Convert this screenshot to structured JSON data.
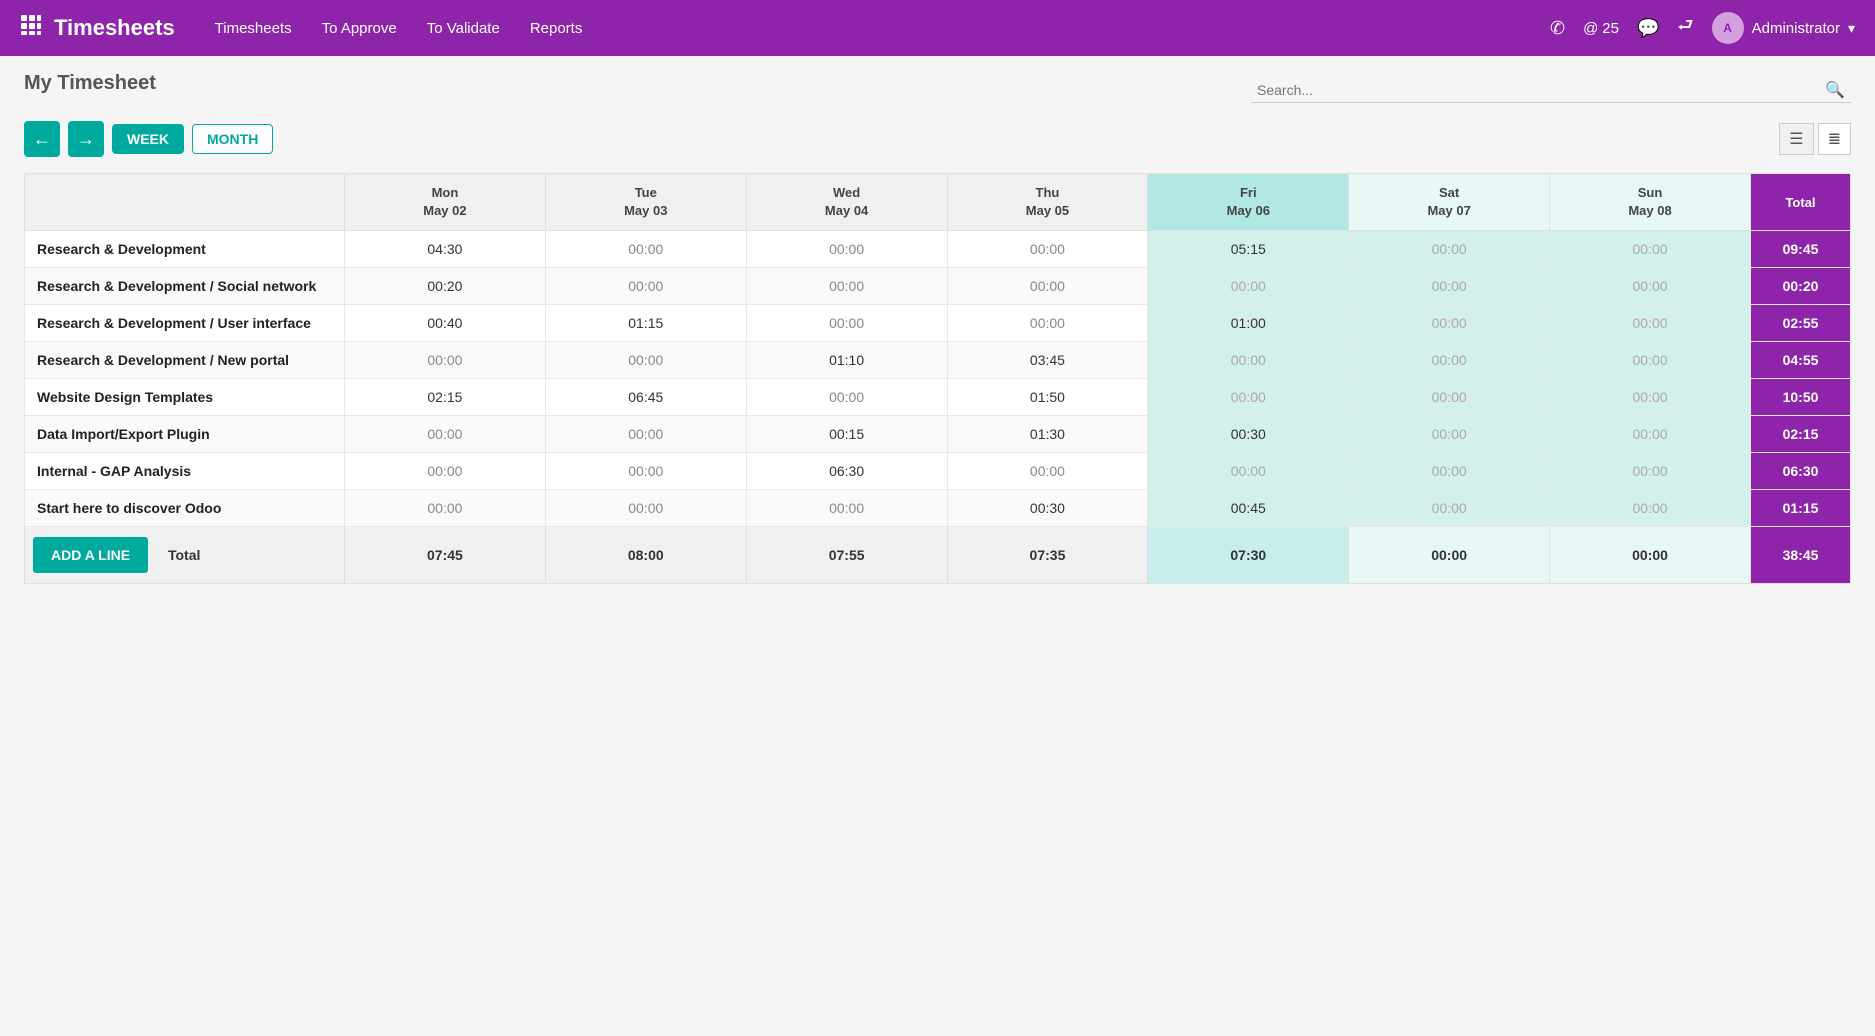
{
  "app": {
    "title": "Timesheets",
    "nav": [
      {
        "label": "Timesheets",
        "key": "timesheets"
      },
      {
        "label": "To Approve",
        "key": "to-approve"
      },
      {
        "label": "To Validate",
        "key": "to-validate"
      },
      {
        "label": "Reports",
        "key": "reports"
      }
    ],
    "notifications": "25",
    "user": "Administrator"
  },
  "page": {
    "title": "My Timesheet",
    "search_placeholder": "Search..."
  },
  "toolbar": {
    "prev_label": "←",
    "next_label": "→",
    "week_label": "WEEK",
    "month_label": "MONTH",
    "add_line_label": "ADD A LINE"
  },
  "columns": [
    {
      "day": "Mon",
      "date": "May 02",
      "key": "mon"
    },
    {
      "day": "Tue",
      "date": "May 03",
      "key": "tue"
    },
    {
      "day": "Wed",
      "date": "May 04",
      "key": "wed"
    },
    {
      "day": "Thu",
      "date": "May 05",
      "key": "thu"
    },
    {
      "day": "Fri",
      "date": "May 06",
      "key": "fri",
      "weekend": true
    },
    {
      "day": "Sat",
      "date": "May 07",
      "key": "sat",
      "weekend": true
    },
    {
      "day": "Sun",
      "date": "May 08",
      "key": "sun",
      "weekend": true
    }
  ],
  "total_header": "Total",
  "rows": [
    {
      "label": "Research & Development",
      "mon": "04:30",
      "tue": "00:00",
      "wed": "00:00",
      "thu": "00:00",
      "fri": "05:15",
      "sat": "00:00",
      "sun": "00:00",
      "total": "09:45",
      "active": {
        "mon": true,
        "fri": true
      }
    },
    {
      "label": "Research & Development / Social network",
      "mon": "00:20",
      "tue": "00:00",
      "wed": "00:00",
      "thu": "00:00",
      "fri": "00:00",
      "sat": "00:00",
      "sun": "00:00",
      "total": "00:20",
      "active": {
        "mon": true
      }
    },
    {
      "label": "Research & Development / User interface",
      "mon": "00:40",
      "tue": "01:15",
      "wed": "00:00",
      "thu": "00:00",
      "fri": "01:00",
      "sat": "00:00",
      "sun": "00:00",
      "total": "02:55",
      "active": {
        "mon": true,
        "tue": true,
        "fri": true
      }
    },
    {
      "label": "Research & Development / New portal",
      "mon": "00:00",
      "tue": "00:00",
      "wed": "01:10",
      "thu": "03:45",
      "fri": "00:00",
      "sat": "00:00",
      "sun": "00:00",
      "total": "04:55",
      "active": {
        "wed": true,
        "thu": true
      }
    },
    {
      "label": "Website Design Templates",
      "mon": "02:15",
      "tue": "06:45",
      "wed": "00:00",
      "thu": "01:50",
      "fri": "00:00",
      "sat": "00:00",
      "sun": "00:00",
      "total": "10:50",
      "active": {
        "mon": true,
        "tue": true,
        "thu": true
      }
    },
    {
      "label": "Data Import/Export Plugin",
      "mon": "00:00",
      "tue": "00:00",
      "wed": "00:15",
      "thu": "01:30",
      "fri": "00:30",
      "sat": "00:00",
      "sun": "00:00",
      "total": "02:15",
      "active": {
        "wed": true,
        "thu": true,
        "fri": true
      }
    },
    {
      "label": "Internal - GAP Analysis",
      "mon": "00:00",
      "tue": "00:00",
      "wed": "06:30",
      "thu": "00:00",
      "fri": "00:00",
      "sat": "00:00",
      "sun": "00:00",
      "total": "06:30",
      "active": {
        "wed": true
      }
    },
    {
      "label": "Start here to discover Odoo",
      "mon": "00:00",
      "tue": "00:00",
      "wed": "00:00",
      "thu": "00:30",
      "fri": "00:45",
      "sat": "00:00",
      "sun": "00:00",
      "total": "01:15",
      "active": {
        "thu": true,
        "fri": true
      }
    }
  ],
  "footer": {
    "total_label": "Total",
    "mon": "07:45",
    "tue": "08:00",
    "wed": "07:55",
    "thu": "07:35",
    "fri": "07:30",
    "sat": "00:00",
    "sun": "00:00",
    "total": "38:45"
  }
}
